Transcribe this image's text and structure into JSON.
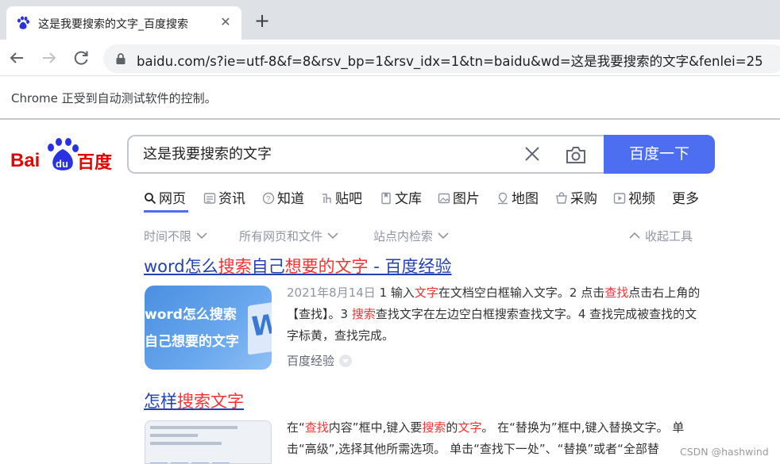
{
  "browser": {
    "tab_title": "这是我要搜索的文字_百度搜索",
    "url": "baidu.com/s?ie=utf-8&f=8&rsv_bp=1&rsv_idx=1&tn=baidu&wd=这是我要搜索的文字&fenlei=25",
    "automation_notice": "Chrome 正受到自动测试软件的控制。"
  },
  "baidu": {
    "search_query": "这是我要搜索的文字",
    "search_button": "百度一下",
    "nav_tabs": [
      {
        "label": "网页",
        "icon": "search-icon"
      },
      {
        "label": "资讯",
        "icon": "news-icon"
      },
      {
        "label": "知道",
        "icon": "question-icon"
      },
      {
        "label": "贴吧",
        "icon": "tieba-icon"
      },
      {
        "label": "文库",
        "icon": "doc-icon"
      },
      {
        "label": "图片",
        "icon": "image-icon"
      },
      {
        "label": "地图",
        "icon": "map-icon"
      },
      {
        "label": "采购",
        "icon": "cart-icon"
      },
      {
        "label": "视频",
        "icon": "video-icon"
      },
      {
        "label": "更多",
        "icon": ""
      }
    ],
    "filters": {
      "time": "时间不限",
      "files": "所有网页和文件",
      "site": "站点内检索",
      "collapse": "收起工具"
    }
  },
  "results": [
    {
      "title_parts": [
        {
          "text": "word怎么",
          "hl": false
        },
        {
          "text": "搜索",
          "hl": true
        },
        {
          "text": "自己",
          "hl": false
        },
        {
          "text": "想要的文字",
          "hl": true
        },
        {
          "text": " - 百度经验",
          "hl": false
        }
      ],
      "thumb_line1": "word怎么搜索",
      "thumb_line2": "自己想要的文字",
      "thumb_letter": "W",
      "date": "2021年8月14日",
      "abstract_parts": [
        {
          "text": " 1 输入",
          "hl": false
        },
        {
          "text": "文字",
          "hl": true
        },
        {
          "text": "在文档空白框输入文字。2 点击",
          "hl": false
        },
        {
          "text": "查找",
          "hl": true
        },
        {
          "text": "点击右上角的【查找】。3 ",
          "hl": false
        },
        {
          "text": "搜索",
          "hl": true
        },
        {
          "text": "查找文字在左边空白框搜索查找文字。4 查找完成被查找的文字标黄，查找完成。",
          "hl": false
        }
      ],
      "source": "百度经验"
    },
    {
      "title_parts": [
        {
          "text": "怎样",
          "hl": false
        },
        {
          "text": "搜索文字",
          "hl": true
        }
      ],
      "abstract_parts": [
        {
          "text": "在“",
          "hl": false
        },
        {
          "text": "查找",
          "hl": true
        },
        {
          "text": "内容”框中,键入要",
          "hl": false
        },
        {
          "text": "搜索",
          "hl": true
        },
        {
          "text": "的",
          "hl": false
        },
        {
          "text": "文字",
          "hl": true
        },
        {
          "text": "。 在“替换为”框中,键入替换文字。 单击“高级”,选择其他所需选项。 单击“查找下一处”、“替换”或者“全部替",
          "hl": false
        }
      ]
    }
  ],
  "watermark": "CSDN @hashwind",
  "colors": {
    "accent": "#4e6ef2",
    "link": "#2440b3",
    "highlight": "#f73131"
  }
}
